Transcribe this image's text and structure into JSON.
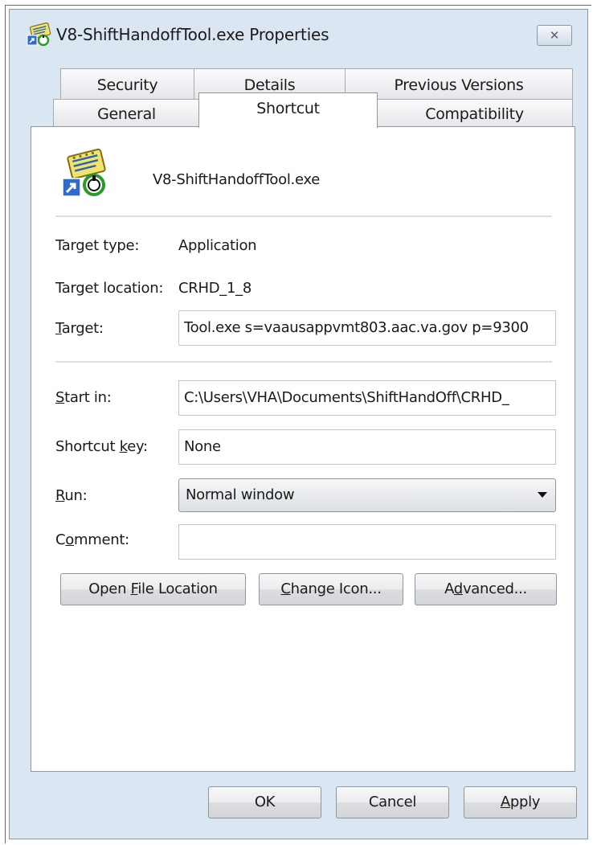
{
  "window": {
    "title": "V8-ShiftHandoffTool.exe Properties",
    "close_glyph": "✕"
  },
  "tabs": {
    "row1": [
      {
        "label": "Security"
      },
      {
        "label": "Details"
      },
      {
        "label": "Previous Versions"
      }
    ],
    "row2": [
      {
        "label": "General"
      },
      {
        "label": "Shortcut",
        "active": true
      },
      {
        "label": "Compatibility"
      }
    ]
  },
  "shortcut": {
    "file_name": "V8-ShiftHandoffTool.exe",
    "target_type": {
      "label": "Target type:",
      "value": "Application"
    },
    "target_location": {
      "label": "Target location:",
      "value": "CRHD_1_8"
    },
    "target": {
      "label_key": "T",
      "label_rest": "arget:",
      "value": "Tool.exe s=vaausappvmt803.aac.va.gov  p=9300"
    },
    "start_in": {
      "label_key": "S",
      "label_rest": "tart in:",
      "value": "C:\\Users\\VHA\\Documents\\ShiftHandOff\\CRHD_"
    },
    "shortcut_key": {
      "label_pre": "Shortcut ",
      "label_key": "k",
      "label_rest": "ey:",
      "value": "None"
    },
    "run": {
      "label_key": "R",
      "label_rest": "un:",
      "value": "Normal window"
    },
    "comment": {
      "label_pre": "C",
      "label_key": "o",
      "label_rest": "mment:",
      "value": ""
    }
  },
  "action_buttons": {
    "open_file_location": {
      "pre": "Open ",
      "key": "F",
      "post": "ile Location"
    },
    "change_icon": {
      "pre": "",
      "key": "C",
      "post": "hange Icon..."
    },
    "advanced": {
      "pre": "A",
      "key": "d",
      "post": "vanced..."
    }
  },
  "dialog_buttons": {
    "ok": "OK",
    "cancel": "Cancel",
    "apply": {
      "key": "A",
      "post": "pply"
    }
  }
}
